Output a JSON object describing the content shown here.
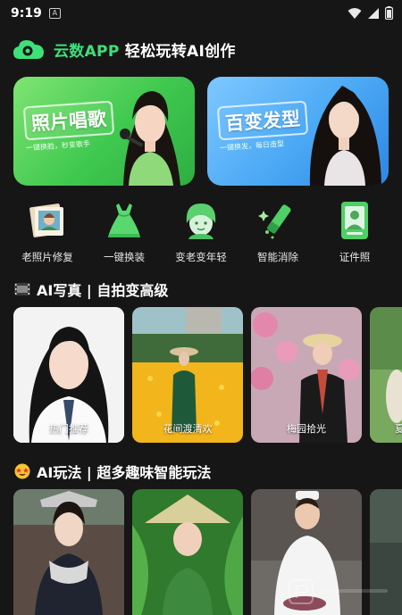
{
  "status_bar": {
    "time": "9:19",
    "notification_glyph": "A"
  },
  "header": {
    "brand": "云数APP",
    "slogan": "轻松玩转AI创作"
  },
  "banners": [
    {
      "title": "照片唱歌",
      "subtitle": "一键换脸，秒变歌手"
    },
    {
      "title": "百变发型",
      "subtitle": "一键换发，每日造型"
    }
  ],
  "features": [
    {
      "label": "老照片修复",
      "icon": "old-photo-icon"
    },
    {
      "label": "一键换装",
      "icon": "dress-icon"
    },
    {
      "label": "变老变年轻",
      "icon": "face-age-icon"
    },
    {
      "label": "智能消除",
      "icon": "magic-eraser-icon"
    },
    {
      "label": "证件照",
      "icon": "id-photo-icon"
    }
  ],
  "sections": {
    "portrait": {
      "title": "AI写真 | 自拍变高级"
    },
    "play": {
      "title": "AI玩法 | 超多趣味智能玩法"
    }
  },
  "portrait_cards": [
    {
      "label": "热门推荐"
    },
    {
      "label": "花间渡清欢"
    },
    {
      "label": "梅园拾光"
    },
    {
      "label": "夏"
    }
  ],
  "colors": {
    "brand_green": "#3ee07a",
    "background": "#161616"
  }
}
